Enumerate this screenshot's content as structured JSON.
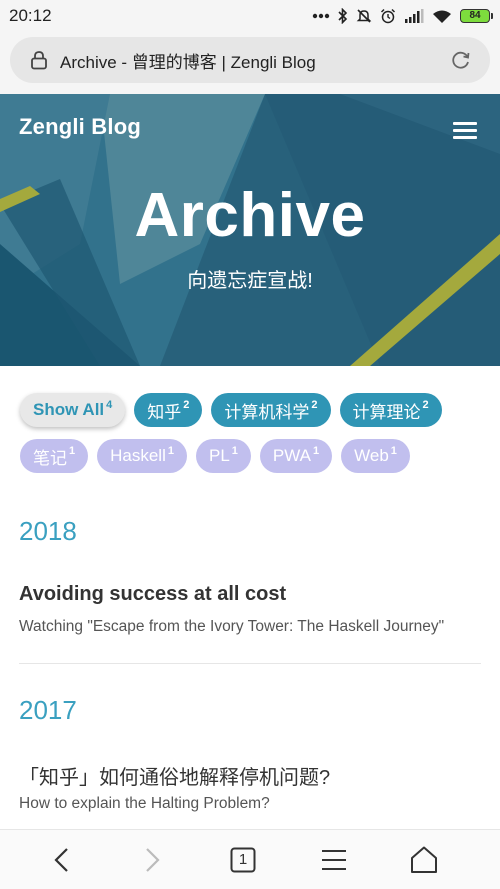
{
  "status_bar": {
    "time": "20:12",
    "battery": "84",
    "icons": [
      "dots-icon",
      "bluetooth-icon",
      "mute-icon",
      "alarm-icon",
      "signal-icon",
      "wifi-icon",
      "battery-icon"
    ]
  },
  "browser": {
    "address": "Archive - 曾理的博客 | Zengli Blog"
  },
  "header": {
    "site_title": "Zengli Blog",
    "page_title": "Archive",
    "subtitle": "向遗忘症宣战!"
  },
  "tags": [
    {
      "label": "Show All",
      "count": "4",
      "style": "active"
    },
    {
      "label": "知乎",
      "count": "2",
      "style": "teal"
    },
    {
      "label": "计算机科学",
      "count": "2",
      "style": "teal"
    },
    {
      "label": "计算理论",
      "count": "2",
      "style": "teal"
    },
    {
      "label": "笔记",
      "count": "1",
      "style": "lavender"
    },
    {
      "label": "Haskell",
      "count": "1",
      "style": "lavender"
    },
    {
      "label": "PL",
      "count": "1",
      "style": "lavender"
    },
    {
      "label": "PWA",
      "count": "1",
      "style": "lavender"
    },
    {
      "label": "Web",
      "count": "1",
      "style": "lavender"
    }
  ],
  "archive": [
    {
      "year": "2018",
      "posts": [
        {
          "title": "Avoiding success at all cost",
          "subtitle": "Watching \"Escape from the Ivory Tower: The Haskell Journey\""
        }
      ]
    },
    {
      "year": "2017",
      "posts": [
        {
          "title": "「知乎」如何通俗地解释停机问题?",
          "subtitle": "How to explain the Halting Problem?"
        }
      ]
    }
  ],
  "bottom_nav": {
    "tab_count": "1"
  },
  "colors": {
    "accent": "#2f95b5",
    "tag_secondary": "#c1bfee",
    "hero_bg": "#2e6a85"
  }
}
